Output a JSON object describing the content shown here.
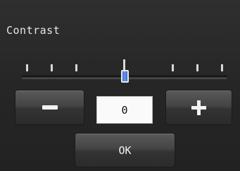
{
  "dialog": {
    "title": "Contrast"
  },
  "slider": {
    "min": -3,
    "max": 3,
    "value": 0,
    "tick_count": 7
  },
  "controls": {
    "decrease_icon": "minus-icon",
    "increase_icon": "plus-icon",
    "value_display": "0",
    "ok_label": "OK"
  },
  "colors": {
    "background": "#262626",
    "thumb": "#4f7fe0",
    "text": "#e6e6e6",
    "value_box": "#fafafa"
  }
}
